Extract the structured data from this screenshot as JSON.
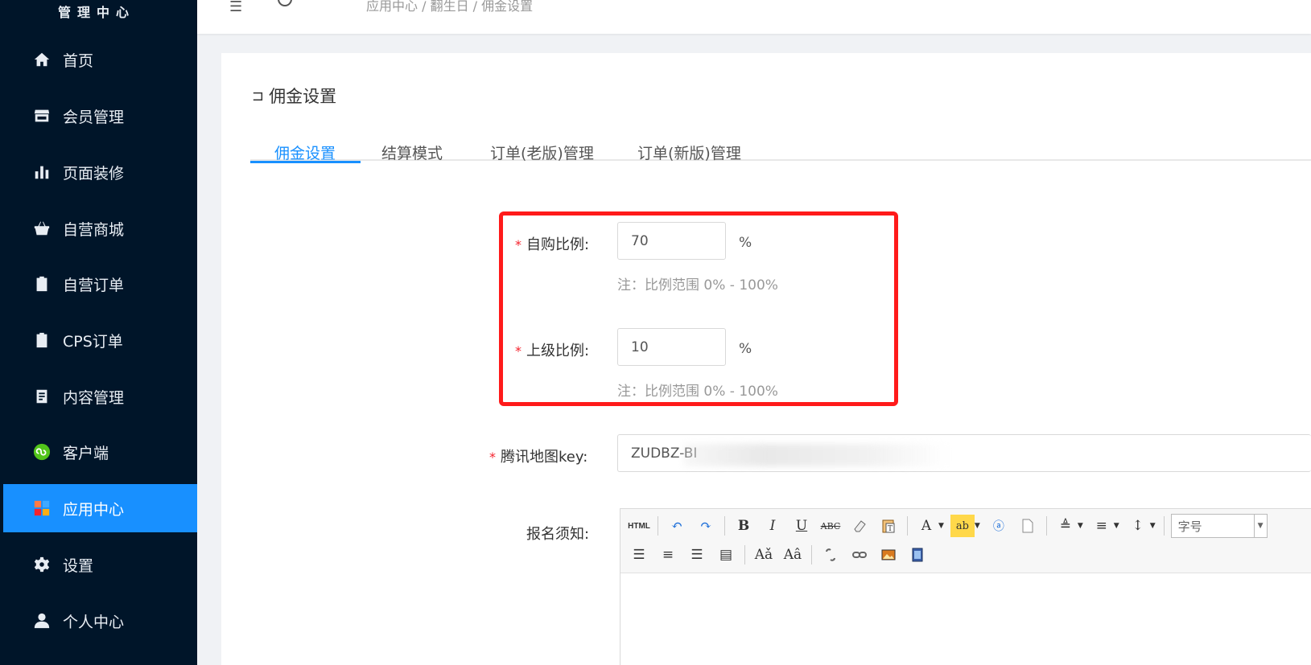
{
  "sidebar": {
    "brand": "管理中心",
    "items": [
      {
        "label": "首页",
        "icon": "home-icon"
      },
      {
        "label": "会员管理",
        "icon": "store-icon"
      },
      {
        "label": "页面装修",
        "icon": "bar-chart-icon"
      },
      {
        "label": "自营商城",
        "icon": "shopping-basket-icon"
      },
      {
        "label": "自营订单",
        "icon": "clipboard-icon"
      },
      {
        "label": "CPS订单",
        "icon": "clipboard-icon"
      },
      {
        "label": "内容管理",
        "icon": "document-icon"
      },
      {
        "label": "客户端",
        "icon": "miniprogram-icon"
      },
      {
        "label": "应用中心",
        "icon": "apps-icon",
        "active": true
      },
      {
        "label": "设置",
        "icon": "gear-icon"
      },
      {
        "label": "个人中心",
        "icon": "user-icon"
      }
    ]
  },
  "header": {
    "breadcrumb": "应用中心 / 翻生日 / 佣金设置"
  },
  "page": {
    "back_label": "佣金设置",
    "tabs": [
      {
        "label": "佣金设置",
        "active": true
      },
      {
        "label": "结算模式"
      },
      {
        "label": "订单(老版)管理"
      },
      {
        "label": "订单(新版)管理"
      }
    ]
  },
  "form": {
    "self_ratio": {
      "label": "自购比例:",
      "value": "70",
      "unit": "%",
      "hint": "注：比例范围 0% - 100%"
    },
    "parent_ratio": {
      "label": "上级比例:",
      "value": "10",
      "unit": "%",
      "hint": "注：比例范围 0% - 100%"
    },
    "map_key": {
      "label": "腾讯地图key:",
      "value": "ZUDBZ-BI"
    },
    "notice": {
      "label": "报名须知:"
    }
  },
  "editor": {
    "font_size_placeholder": "字号",
    "html_label": "HTML"
  },
  "colors": {
    "sidebar_bg": "#001529",
    "accent": "#1890ff",
    "required": "#f5222d",
    "highlight": "#ff1a1a"
  }
}
